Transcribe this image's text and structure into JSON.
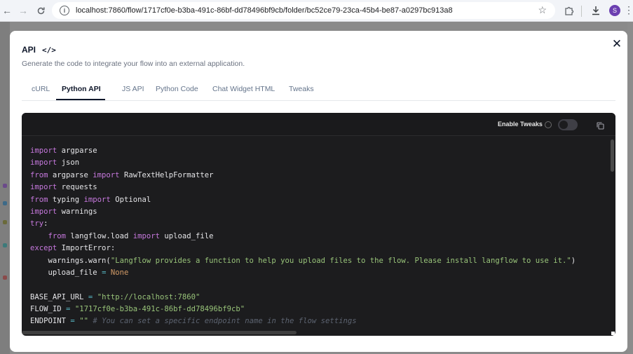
{
  "browser": {
    "url": "localhost:7860/flow/1717cf0e-b3ba-491c-86bf-dd78496bf9cb/folder/bc52ce79-23ca-45b4-be87-a0297bc913a8",
    "profile_initial": "S"
  },
  "modal": {
    "title": "API",
    "title_icon": "code-brackets-icon",
    "description": "Generate the code to integrate your flow into an external application.",
    "close_icon": "close-icon",
    "tabs": [
      {
        "label": "cURL",
        "active": false
      },
      {
        "label": "Python API",
        "active": true
      },
      {
        "label": "JS API",
        "active": false
      },
      {
        "label": "Python Code",
        "active": false
      },
      {
        "label": "Chat Widget HTML",
        "active": false
      },
      {
        "label": "Tweaks",
        "active": false
      }
    ],
    "code_panel": {
      "enable_tweaks_label": "Enable Tweaks",
      "enable_tweaks_on": false,
      "copy_icon": "copy-icon",
      "lines": [
        [
          {
            "t": "kw",
            "v": "import"
          },
          {
            "t": "tx",
            "v": " argparse"
          }
        ],
        [
          {
            "t": "kw",
            "v": "import"
          },
          {
            "t": "tx",
            "v": " json"
          }
        ],
        [
          {
            "t": "kw",
            "v": "from"
          },
          {
            "t": "tx",
            "v": " argparse "
          },
          {
            "t": "kw",
            "v": "import"
          },
          {
            "t": "tx",
            "v": " RawTextHelpFormatter"
          }
        ],
        [
          {
            "t": "kw",
            "v": "import"
          },
          {
            "t": "tx",
            "v": " requests"
          }
        ],
        [
          {
            "t": "kw",
            "v": "from"
          },
          {
            "t": "tx",
            "v": " typing "
          },
          {
            "t": "kw",
            "v": "import"
          },
          {
            "t": "tx",
            "v": " Optional"
          }
        ],
        [
          {
            "t": "kw",
            "v": "import"
          },
          {
            "t": "tx",
            "v": " warnings"
          }
        ],
        [
          {
            "t": "kw",
            "v": "try"
          },
          {
            "t": "tx",
            "v": ":"
          }
        ],
        [
          {
            "t": "tx",
            "v": "    "
          },
          {
            "t": "kw",
            "v": "from"
          },
          {
            "t": "tx",
            "v": " langflow.load "
          },
          {
            "t": "kw",
            "v": "import"
          },
          {
            "t": "tx",
            "v": " upload_file"
          }
        ],
        [
          {
            "t": "kw",
            "v": "except"
          },
          {
            "t": "tx",
            "v": " ImportError:"
          }
        ],
        [
          {
            "t": "tx",
            "v": "    warnings.warn("
          },
          {
            "t": "str",
            "v": "\"Langflow provides a function to help you upload files to the flow. Please install langflow to use it.\""
          },
          {
            "t": "tx",
            "v": ")"
          }
        ],
        [
          {
            "t": "tx",
            "v": "    upload_file "
          },
          {
            "t": "op",
            "v": "="
          },
          {
            "t": "tx",
            "v": " "
          },
          {
            "t": "num",
            "v": "None"
          }
        ],
        [
          {
            "t": "tx",
            "v": ""
          }
        ],
        [
          {
            "t": "tx",
            "v": "BASE_API_URL "
          },
          {
            "t": "op",
            "v": "="
          },
          {
            "t": "tx",
            "v": " "
          },
          {
            "t": "str",
            "v": "\"http://localhost:7860\""
          }
        ],
        [
          {
            "t": "tx",
            "v": "FLOW_ID "
          },
          {
            "t": "op",
            "v": "="
          },
          {
            "t": "tx",
            "v": " "
          },
          {
            "t": "str",
            "v": "\"1717cf0e-b3ba-491c-86bf-dd78496bf9cb\""
          }
        ],
        [
          {
            "t": "tx",
            "v": "ENDPOINT "
          },
          {
            "t": "op",
            "v": "="
          },
          {
            "t": "tx",
            "v": " "
          },
          {
            "t": "str",
            "v": "\"\""
          },
          {
            "t": "tx",
            "v": " "
          },
          {
            "t": "cm",
            "v": "# You can set a specific endpoint name in the flow settings"
          }
        ]
      ]
    }
  }
}
